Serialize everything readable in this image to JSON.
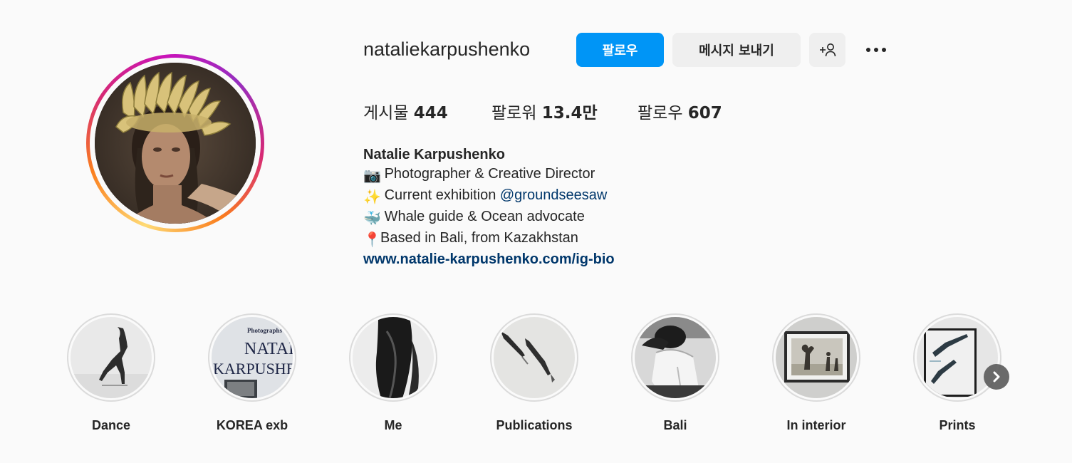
{
  "profile": {
    "username": "nataliekarpushenko",
    "follow_label": "팔로우",
    "message_label": "메시지 보내기"
  },
  "stats": {
    "posts_label": "게시물",
    "posts_value": "444",
    "followers_label": "팔로워",
    "followers_value": "13.4만",
    "following_label": "팔로우",
    "following_value": "607"
  },
  "bio": {
    "name": "Natalie Karpushenko",
    "line1_emoji": "📷",
    "line1_text": "Photographer & Creative Director",
    "line2_emoji": "✨",
    "line2_text": "Current exhibition ",
    "line2_mention": "@groundseesaw",
    "line3_emoji": "🐳",
    "line3_text": "Whale guide & Ocean advocate",
    "line4_emoji": "📍",
    "line4_text": "Based in Bali, from Kazakhstan",
    "link": "www.natalie-karpushenko.com/ig-bio"
  },
  "highlights": [
    {
      "label": "Dance"
    },
    {
      "label": "KOREA exb",
      "cover_text_1": "Photographs by",
      "cover_text_2": "NATALIE",
      "cover_text_3": "KARPUSHEN"
    },
    {
      "label": "Me"
    },
    {
      "label": "Publications"
    },
    {
      "label": "Bali"
    },
    {
      "label": "In interior"
    },
    {
      "label": "Prints"
    }
  ],
  "colors": {
    "accent": "#0095f6",
    "link": "#00376b",
    "button_grey": "#efefef",
    "text": "#262626",
    "background": "#fafafa"
  },
  "icons": {
    "add_user": "add-user-icon",
    "more": "more-options-icon",
    "next": "chevron-right-icon"
  }
}
